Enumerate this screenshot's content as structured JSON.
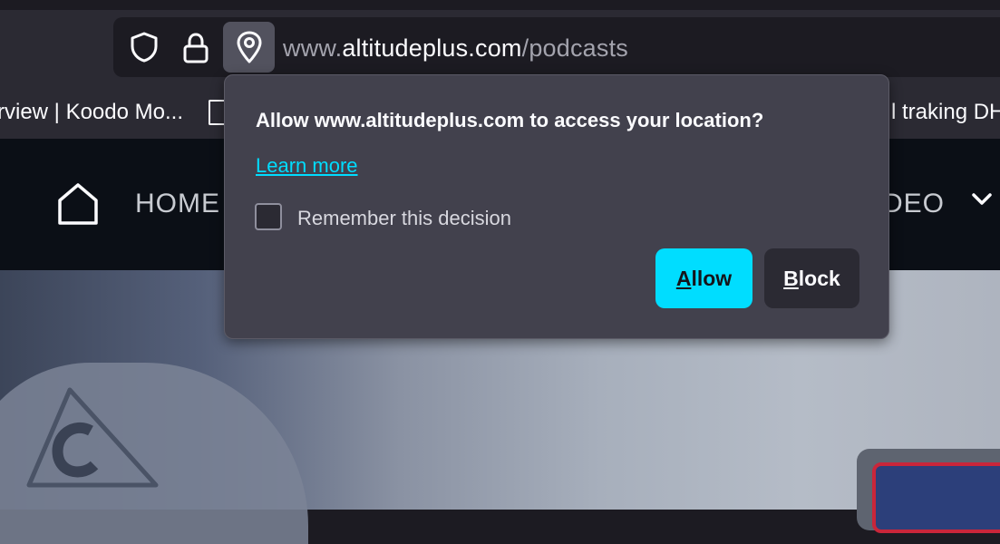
{
  "browser": {
    "url": {
      "prefix": "www.",
      "domain": "altitudeplus.com",
      "path": "/podcasts"
    },
    "bookmarks": {
      "left_label": "rview | Koodo Mo...",
      "right_label": "l traking DH"
    }
  },
  "site": {
    "nav": {
      "home_label": "HOME",
      "video_label": "DEO"
    }
  },
  "permission_popup": {
    "title": "Allow www.altitudeplus.com to access your location?",
    "learn_more": "Learn more",
    "remember_label": "Remember this decision",
    "remember_checked": false,
    "allow_accel": "A",
    "allow_rest": "llow",
    "block_accel": "B",
    "block_rest": "lock"
  },
  "colors": {
    "accent": "#00ddff",
    "popup_bg": "#42414d",
    "toolbar_bg": "#2b2a33"
  },
  "icons": {
    "shield": "tracking-protection-shield-icon",
    "lock": "lock-icon",
    "location": "location-pin-icon",
    "home": "home-icon",
    "chevron": "chevron-down-icon"
  }
}
